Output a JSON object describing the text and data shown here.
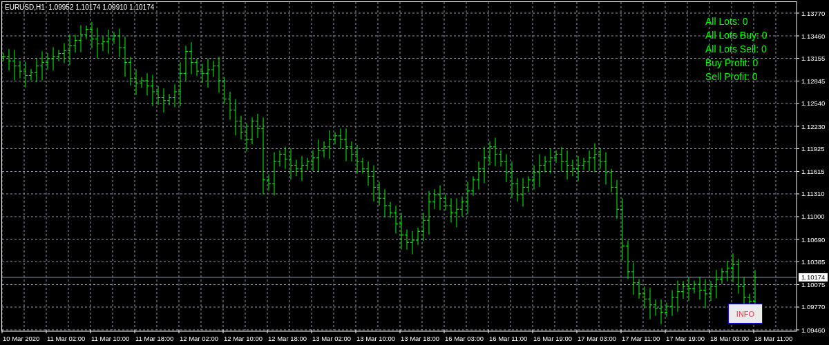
{
  "chart_header": "EURUSD,H1  1.09952 1.10174 1.09910 1.10174",
  "account_info": [
    "All Lots: 0",
    "All Lots Buy: 0",
    "All Lots Sell: 0",
    "Buy Profit: 0",
    "Sell Profit: 0"
  ],
  "info_button": "INFO",
  "current_price_label": "1.10174",
  "price_axis": [
    "1.13770",
    "1.13460",
    "1.13155",
    "1.12845",
    "1.12540",
    "1.12230",
    "1.11925",
    "1.11615",
    "1.11310",
    "1.11000",
    "1.10690",
    "1.10385",
    "1.10075",
    "1.09770",
    "1.09460"
  ],
  "time_axis": [
    "10 Mar 2020",
    "11 Mar 02:00",
    "11 Mar 10:00",
    "11 Mar 18:00",
    "12 Mar 02:00",
    "12 Mar 10:00",
    "12 Mar 18:00",
    "13 Mar 02:00",
    "13 Mar 10:00",
    "13 Mar 18:00",
    "16 Mar 03:00",
    "16 Mar 11:00",
    "16 Mar 19:00",
    "17 Mar 03:00",
    "17 Mar 11:00",
    "17 Mar 19:00",
    "18 Mar 03:00",
    "18 Mar 11:00"
  ]
}
